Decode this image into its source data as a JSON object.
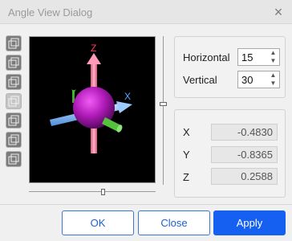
{
  "window": {
    "title": "Angle View Dialog"
  },
  "toolbar": {
    "buttons": [
      "view-cube-icon",
      "view-cube-icon",
      "view-cube-icon",
      "view-cube-icon",
      "view-cube-icon",
      "view-cube-icon",
      "view-cube-icon"
    ]
  },
  "viewport": {
    "axes": {
      "x": "X",
      "y": "Y",
      "z": "Z"
    }
  },
  "angles": {
    "horizontal_label": "Horizontal",
    "horizontal_value": "15",
    "vertical_label": "Vertical",
    "vertical_value": "30"
  },
  "coords": {
    "x_label": "X",
    "x_value": "-0.4830",
    "y_label": "Y",
    "y_value": "-0.8365",
    "z_label": "Z",
    "z_value": "0.2588"
  },
  "buttons": {
    "ok": "OK",
    "close": "Close",
    "apply": "Apply"
  },
  "colors": {
    "accent": "#1560f0",
    "sphere": "#b01ab8",
    "z_axis": "#ff8fb0",
    "x_axis": "#7ab6ff",
    "y_axis": "#4fbf3c"
  }
}
